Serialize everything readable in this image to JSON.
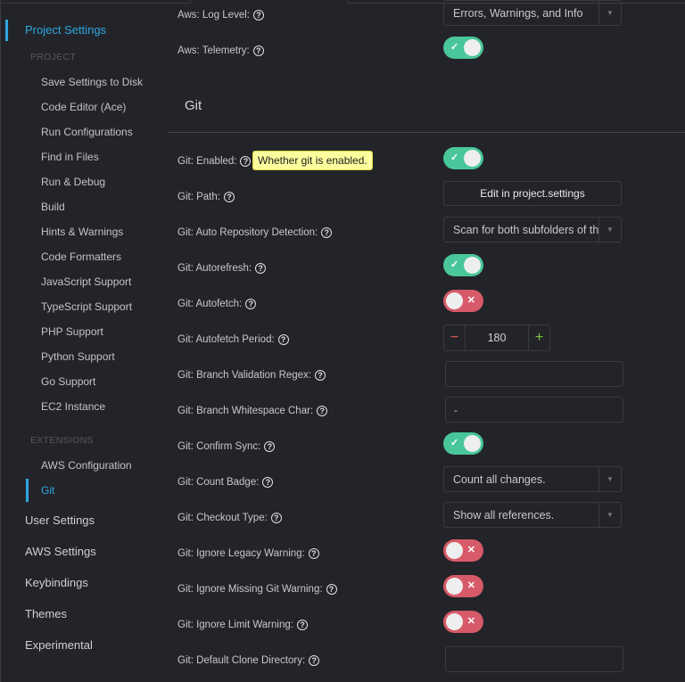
{
  "sidebar": {
    "project_settings": "Project Settings",
    "project_section": "PROJECT",
    "project_items": [
      "Save Settings to Disk",
      "Code Editor (Ace)",
      "Run Configurations",
      "Find in Files",
      "Run & Debug",
      "Build",
      "Hints & Warnings",
      "Code Formatters",
      "JavaScript Support",
      "TypeScript Support",
      "PHP Support",
      "Python Support",
      "Go Support",
      "EC2 Instance"
    ],
    "extensions_section": "EXTENSIONS",
    "extension_items": [
      "AWS Configuration",
      "Git"
    ],
    "bottom_items": [
      "User Settings",
      "AWS Settings",
      "Keybindings",
      "Themes",
      "Experimental"
    ]
  },
  "main": {
    "aws_log_level": {
      "label": "Aws: Log Level:",
      "value": "Errors, Warnings, and Info"
    },
    "aws_telemetry": {
      "label": "Aws: Telemetry:",
      "on": true
    },
    "git_heading": "Git",
    "tooltip": "Whether git is enabled.",
    "help_glyph": "?",
    "rows": [
      {
        "label": "Git: Enabled:",
        "type": "toggle",
        "on": true
      },
      {
        "label": "Git: Path:",
        "type": "button",
        "value": "Edit in project.settings"
      },
      {
        "label": "Git: Auto Repository Detection:",
        "type": "select",
        "value": "Scan for both subfolders of the"
      },
      {
        "label": "Git: Autorefresh:",
        "type": "toggle",
        "on": true
      },
      {
        "label": "Git: Autofetch:",
        "type": "toggle",
        "on": false
      },
      {
        "label": "Git: Autofetch Period:",
        "type": "stepper",
        "value": "180"
      },
      {
        "label": "Git: Branch Validation Regex:",
        "type": "input",
        "value": ""
      },
      {
        "label": "Git: Branch Whitespace Char:",
        "type": "input",
        "value": "-"
      },
      {
        "label": "Git: Confirm Sync:",
        "type": "toggle",
        "on": true
      },
      {
        "label": "Git: Count Badge:",
        "type": "select",
        "value": "Count all changes."
      },
      {
        "label": "Git: Checkout Type:",
        "type": "select",
        "value": "Show all references."
      },
      {
        "label": "Git: Ignore Legacy Warning:",
        "type": "toggle",
        "on": false
      },
      {
        "label": "Git: Ignore Missing Git Warning:",
        "type": "toggle",
        "on": false
      },
      {
        "label": "Git: Ignore Limit Warning:",
        "type": "toggle",
        "on": false
      },
      {
        "label": "Git: Default Clone Directory:",
        "type": "input",
        "value": ""
      }
    ],
    "stepper_minus": "−",
    "stepper_plus": "+",
    "check": "✓",
    "cross": "✕",
    "arrow": "▼"
  },
  "colors": {
    "accent": "#2ea7e0",
    "toggle_on": "#49c79b",
    "toggle_off": "#d65a69"
  }
}
